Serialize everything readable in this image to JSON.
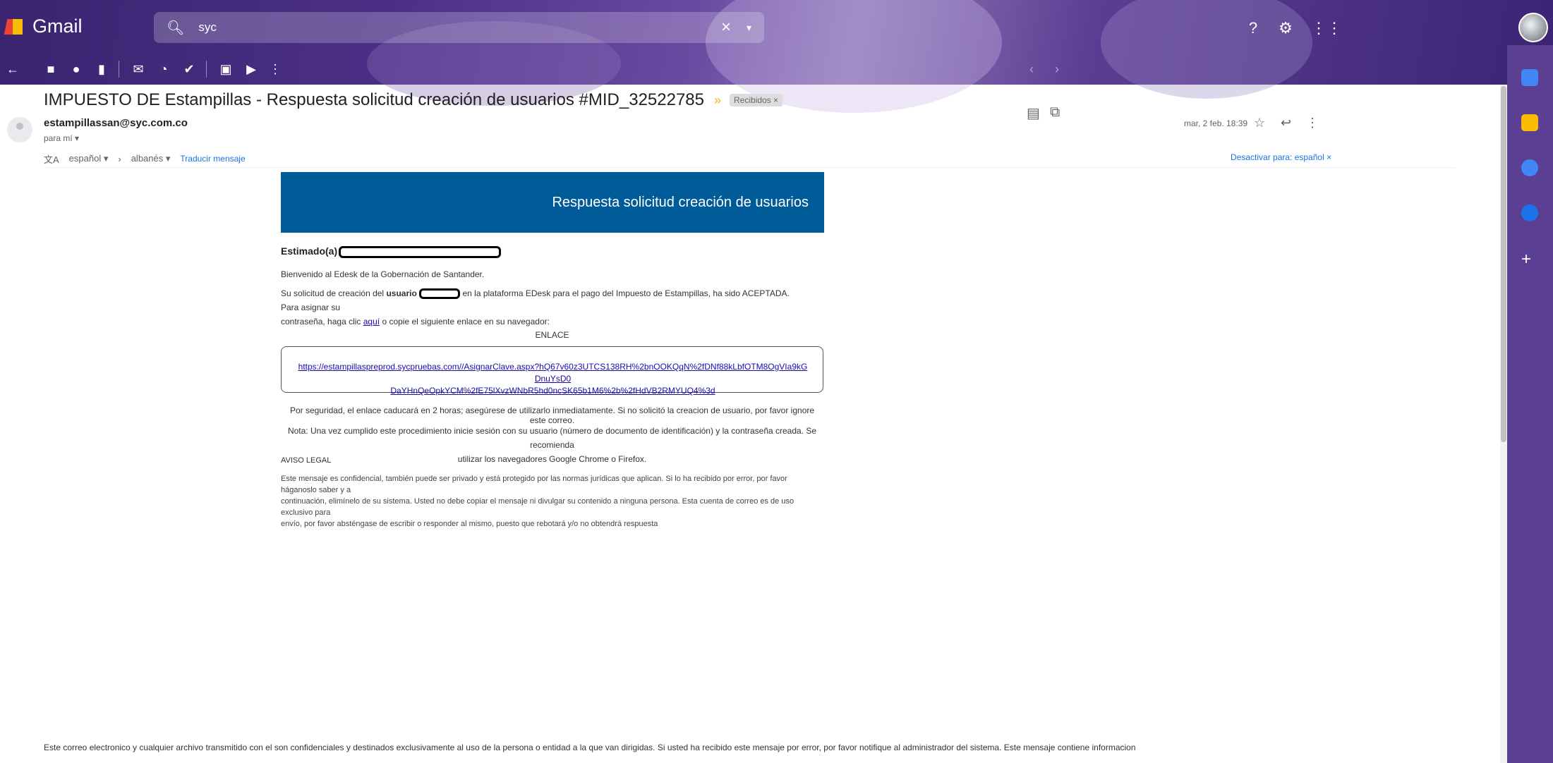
{
  "app": {
    "name": "Gmail"
  },
  "search": {
    "value": "syc"
  },
  "toolbar": {
    "icons": [
      "back-icon",
      "archive-icon",
      "report-spam-icon",
      "delete-icon",
      "mark-unread-icon",
      "snooze-icon",
      "add-to-tasks-icon",
      "move-to-icon",
      "labels-icon",
      "more-icon"
    ]
  },
  "email": {
    "subject": "IMPUESTO DE Estampillas - Respuesta solicitud creación de usuarios #MID_32522785",
    "label": "Recibidos ×",
    "sender": "estampillassan@syc.com.co",
    "recipient": "para mí ▾",
    "date": "mar, 2 feb. 18:39"
  },
  "translate": {
    "from": "español ▾",
    "arrow": "›",
    "to": "albanés ▾",
    "action": "Traducir mensaje",
    "disable": "Desactivar para: español ×"
  },
  "body": {
    "banner_title": "Respuesta solicitud creación de usuarios",
    "greeting": "Estimado(a)",
    "welcome": "Bienvenido al Edesk de la Gobernación de Santander.",
    "request_pre": "Su solicitud de creación del",
    "request_user": "usuario",
    "request_post": "en la plataforma EDesk para el pago del Impuesto de Estampillas, ha sido ACEPTADA. Para asignar su",
    "request_line2_pre": "contraseña, haga clic",
    "request_link": "aquí",
    "request_line2_post": "o copie el siguiente enlace en su navegador:",
    "enlace_title": "ENLACE",
    "enlace_url_line1": "https://estampillaspreprod.sycpruebas.com//AsignarClave.aspx?hQ67v60z3UTCS138RH%2bnOOKQqN%2fDNf88kLbfOTM8OgVIa9kGDnuYsD0",
    "enlace_url_line2": "DaYHnQeOpkYCM%2fE75lXvzWNbR5hd0ncSK65b1M6%2b%2fHdVB2RMYUQ4%3d",
    "security": "Por seguridad, el enlace caducará en 2 horas; asegúrese de utilizarlo inmediatamente. Si no solicitó la creacion de usuario, por favor ignore este correo.",
    "note_line1": "Nota: Una vez cumplido este procedimiento inicie sesión con su usuario (número de documento de identificación) y la contraseña creada. Se recomienda",
    "note_line2": "utilizar los navegadores Google Chrome o Firefox.",
    "legal_title": "AVISO LEGAL",
    "legal_line1": "Este mensaje es confidencial, también puede ser privado y está protegido por las normas jurídicas que aplican. Si lo ha recibido por error, por favor háganoslo saber y a",
    "legal_line2": "continuación, elimínelo de su sistema. Usted no debe copiar el mensaje ni divulgar su contenido a ninguna persona. Esta cuenta de correo es de uso exclusivo para",
    "legal_line3": "envío, por favor absténgase de escribir o responder al mismo, puesto que rebotará y/o no obtendrá respuesta",
    "footer": "Este correo electronico y cualquier archivo transmitido con el son confidenciales y destinados exclusivamente al uso de la persona o entidad a la que van dirigidas. Si usted ha recibido este mensaje por error, por favor notifique al administrador del sistema. Este mensaje contiene informacion"
  },
  "colors": {
    "banner": "#005b99",
    "header_purple": "#4b2f86",
    "link": "#1a73e8"
  }
}
